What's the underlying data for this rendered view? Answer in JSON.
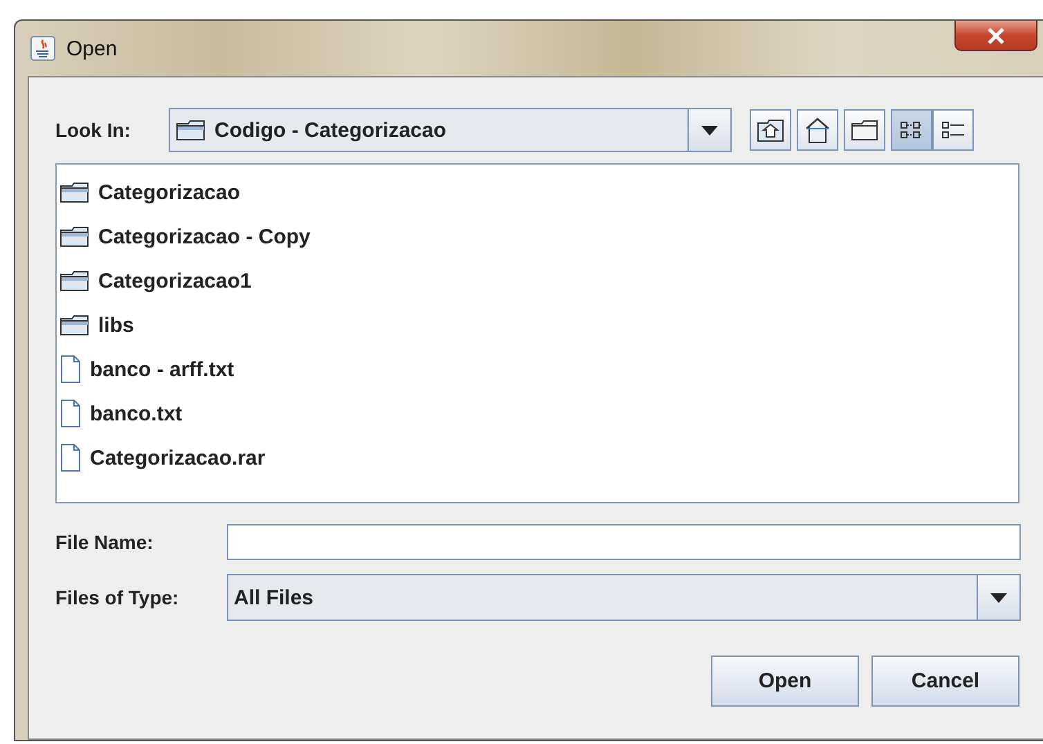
{
  "window": {
    "title": "Open"
  },
  "look_in": {
    "label": "Look In:",
    "value": "Codigo - Categorizacao"
  },
  "toolbar": [
    {
      "kind": "up",
      "selected": false
    },
    {
      "kind": "home",
      "selected": false
    },
    {
      "kind": "newfolder",
      "selected": false
    },
    {
      "kind": "list",
      "selected": true
    },
    {
      "kind": "details",
      "selected": false
    }
  ],
  "files": [
    {
      "name": "Categorizacao",
      "kind": "folder"
    },
    {
      "name": "Categorizacao - Copy",
      "kind": "folder"
    },
    {
      "name": "Categorizacao1",
      "kind": "folder"
    },
    {
      "name": "libs",
      "kind": "folder"
    },
    {
      "name": "banco - arff.txt",
      "kind": "file"
    },
    {
      "name": "banco.txt",
      "kind": "file"
    },
    {
      "name": "Categorizacao.rar",
      "kind": "file"
    }
  ],
  "file_name": {
    "label": "File Name:"
  },
  "file_type": {
    "label": "Files of Type:",
    "value": "All Files"
  },
  "buttons": [
    "Open",
    "Cancel"
  ]
}
